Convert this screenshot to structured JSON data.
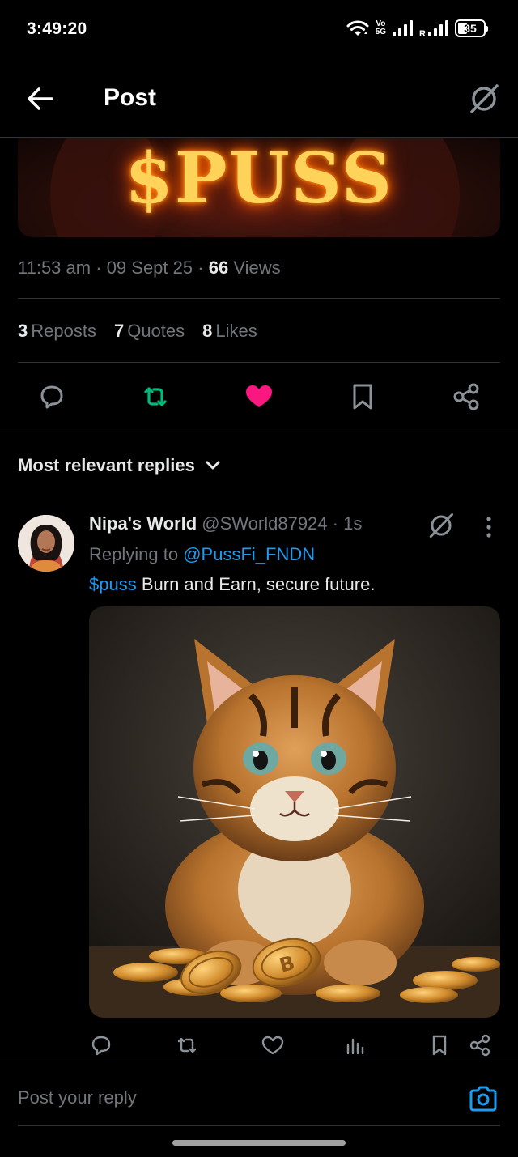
{
  "status_bar": {
    "time": "3:49:20",
    "volte_top": "Vo",
    "volte_bottom": "5G",
    "roaming": "R",
    "battery": "35",
    "battery_level": 0.35
  },
  "header": {
    "title": "Post"
  },
  "post": {
    "banner_text": "$PUSS",
    "time": "11:53 am",
    "date": "09 Sept 25",
    "views_count": "66",
    "views_label": "Views",
    "reposts_count": "3",
    "reposts_label": "Reposts",
    "quotes_count": "7",
    "quotes_label": "Quotes",
    "likes_count": "8",
    "likes_label": "Likes"
  },
  "replies_sort": {
    "label": "Most relevant replies"
  },
  "reply": {
    "name": "Nipa's World",
    "handle": "@SWorld87924",
    "age": "1s",
    "replying_prefix": "Replying to",
    "replying_to": "@PussFi_FNDN",
    "cashtag": "$puss",
    "text": " Burn and Earn, secure future."
  },
  "compose": {
    "placeholder": "Post your reply"
  },
  "colors": {
    "accent": "#1d9bf0",
    "like": "#f91880",
    "repost": "#00ba7c",
    "muted": "#71767b",
    "text": "#e7e9ea",
    "background": "#000000"
  },
  "icons": {
    "back": "arrow-left-icon",
    "grok": "grok-icon",
    "reply": "comment-icon",
    "repost": "repost-icon",
    "like": "heart-icon",
    "bookmark": "bookmark-icon",
    "share": "share-icon",
    "views": "analytics-icon",
    "more": "more-vertical-icon",
    "camera": "camera-icon",
    "sort": "chevron-down-icon"
  }
}
